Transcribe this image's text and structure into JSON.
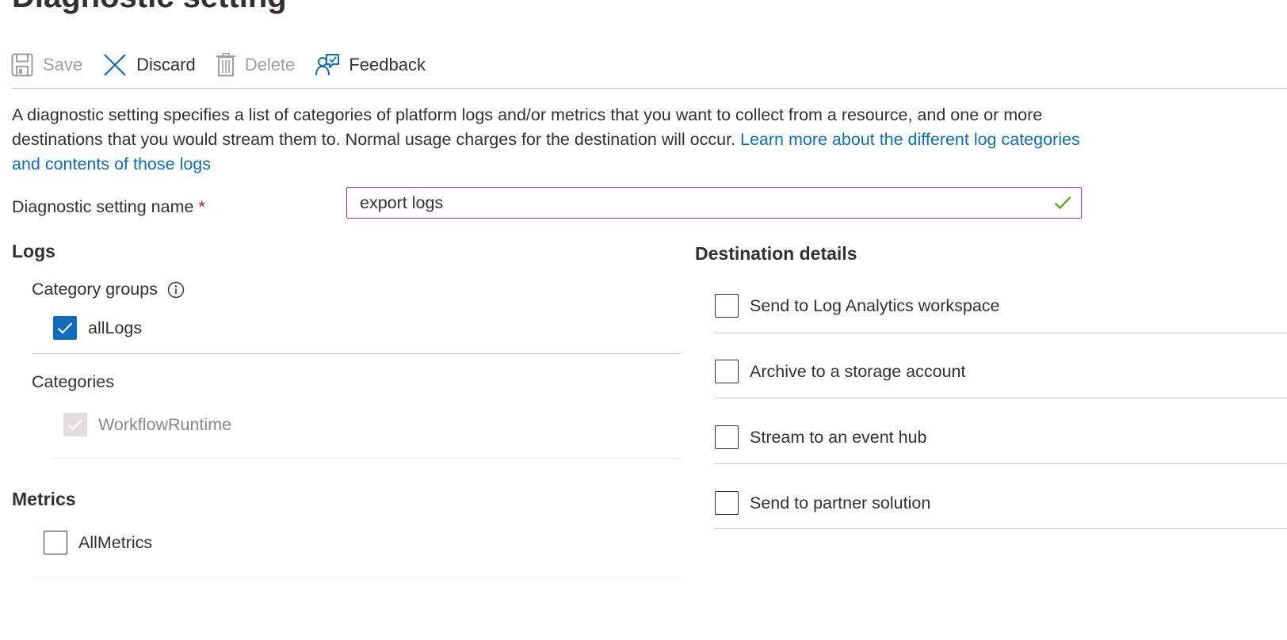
{
  "page": {
    "title": "Diagnostic setting"
  },
  "toolbar": {
    "save_label": "Save",
    "discard_label": "Discard",
    "delete_label": "Delete",
    "feedback_label": "Feedback"
  },
  "description": {
    "text": "A diagnostic setting specifies a list of categories of platform logs and/or metrics that you want to collect from a resource, and one or more destinations that you would stream them to. Normal usage charges for the destination will occur. ",
    "link_text": "Learn more about the different log categories and contents of those logs"
  },
  "name_field": {
    "label": "Diagnostic setting name",
    "required_marker": "*",
    "value": "export logs"
  },
  "logs": {
    "title": "Logs",
    "category_groups_label": "Category groups",
    "category_groups": [
      {
        "label": "allLogs",
        "checked": true
      }
    ],
    "categories_label": "Categories",
    "categories": [
      {
        "label": "WorkflowRuntime",
        "checked": true,
        "disabled": true
      }
    ]
  },
  "metrics": {
    "title": "Metrics",
    "items": [
      {
        "label": "AllMetrics",
        "checked": false
      }
    ]
  },
  "destination": {
    "title": "Destination details",
    "options": [
      {
        "label": "Send to Log Analytics workspace",
        "checked": false
      },
      {
        "label": "Archive to a storage account",
        "checked": false
      },
      {
        "label": "Stream to an event hub",
        "checked": false
      },
      {
        "label": "Send to partner solution",
        "checked": false
      }
    ]
  },
  "colors": {
    "accent": "#0f6cbd",
    "input_border_focus": "#8e39c9",
    "valid_check": "#57a300",
    "required": "#a4262c"
  }
}
